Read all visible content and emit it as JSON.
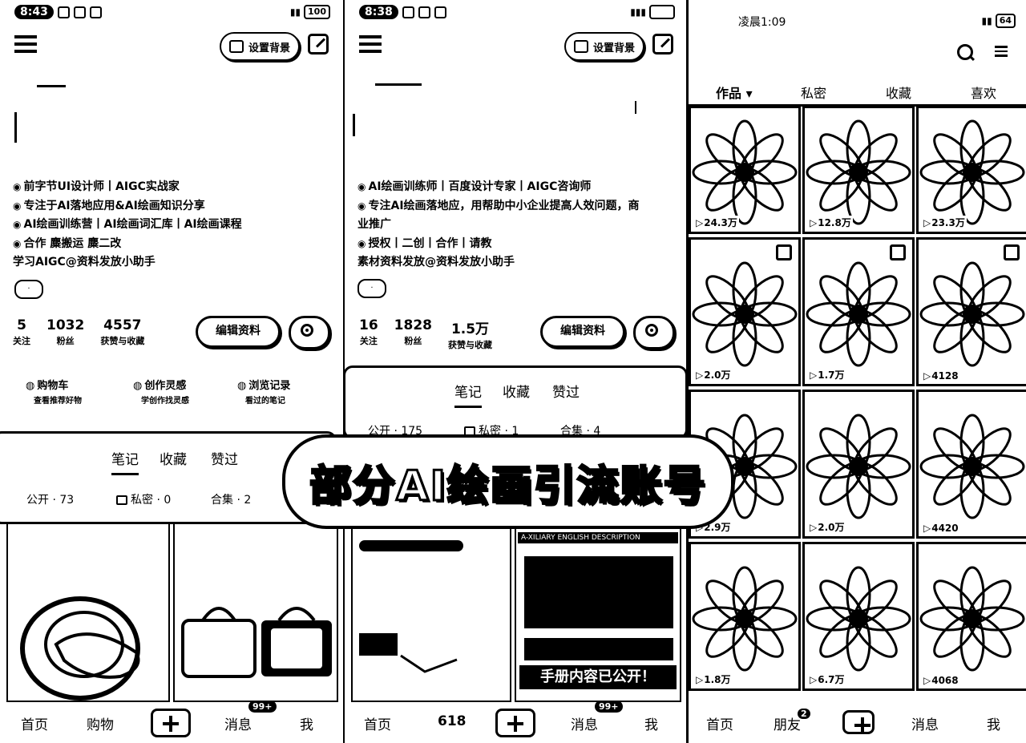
{
  "panel1": {
    "status_time": "8:43",
    "battery": "100",
    "set_background_label": "设置背景",
    "bio": [
      "前字节UI设计师丨AIGC实战家",
      "专注于AI落地应用&AI绘画知识分享",
      "AI绘画训练营丨AI绘画词汇库丨AI绘画课程",
      "合作 麋搬运 麋二改",
      "学习AIGC@资料发放小助手"
    ],
    "stats": [
      {
        "num": "5",
        "label": "关注"
      },
      {
        "num": "1032",
        "label": "粉丝"
      },
      {
        "num": "4557",
        "label": "获赞与收藏"
      }
    ],
    "edit_label": "编辑资料",
    "quick": [
      {
        "title": "购物车",
        "sub": "查看推荐好物"
      },
      {
        "title": "创作灵感",
        "sub": "学创作找灵感"
      },
      {
        "title": "浏览记录",
        "sub": "看过的笔记"
      }
    ],
    "tabs": [
      "笔记",
      "收藏",
      "赞过"
    ],
    "subtabs": [
      "公开 · 73",
      "私密 · 0",
      "合集 · 2"
    ],
    "nav": [
      "首页",
      "购物",
      "消息",
      "我"
    ],
    "badge": "99+"
  },
  "panel2": {
    "status_time": "8:38",
    "set_background_label": "设置背景",
    "bio": [
      "AI绘画训练师丨百度设计专家丨AIGC咨询师",
      "专注AI绘画落地应，用帮助中小企业提高人效问题，商",
      "业推广",
      "授权丨二创丨合作丨请教",
      "素材资料发放@资料发放小助手"
    ],
    "stats": [
      {
        "num": "16",
        "label": "关注"
      },
      {
        "num": "1828",
        "label": "粉丝"
      },
      {
        "num": "1.5万",
        "label": "获赞与收藏"
      }
    ],
    "edit_label": "编辑资料",
    "tabs": [
      "笔记",
      "收藏",
      "赞过"
    ],
    "subtabs": [
      "公开 · 175",
      "私密 · 1",
      "合集 · 4"
    ],
    "thumb_texts": [
      "A-XILIARY ENGLISH DESCRIPTION",
      "手册内容已公开！"
    ],
    "nav": [
      "首页",
      "618",
      "消息",
      "我"
    ],
    "badge": "99+"
  },
  "panel3": {
    "status_time": "凌晨1:09",
    "battery": "64",
    "tabs": [
      "作品 ▾",
      "私密",
      "收藏",
      "喜欢"
    ],
    "counts": [
      "24.3万",
      "12.8万",
      "23.3万",
      "2.0万",
      "1.7万",
      "4128",
      "2.9万",
      "2.0万",
      "4420",
      "1.8万",
      "6.7万",
      "4068"
    ],
    "nav": [
      "首页",
      "朋友",
      "消息",
      "我"
    ],
    "badge": "2"
  },
  "overlay_title": "部分AI绘画引流账号"
}
